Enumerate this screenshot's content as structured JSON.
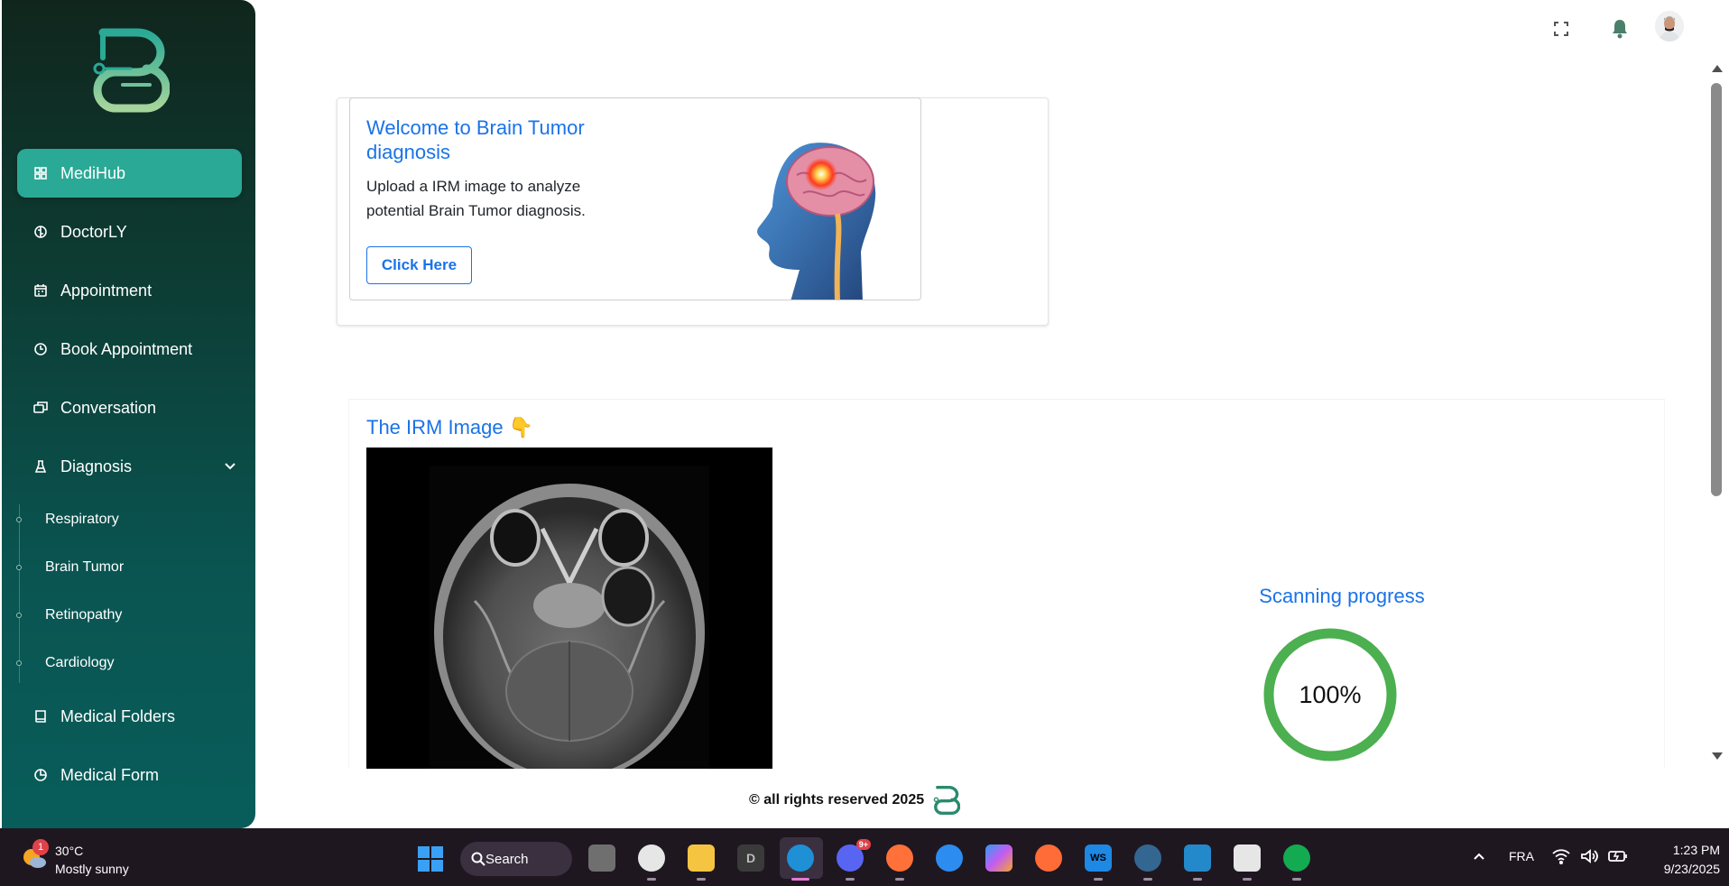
{
  "sidebar": {
    "items": [
      {
        "label": "MediHub",
        "icon": "grid-icon",
        "active": true
      },
      {
        "label": "DoctorLY",
        "icon": "brain-icon"
      },
      {
        "label": "Appointment",
        "icon": "calendar-icon"
      },
      {
        "label": "Book Appointment",
        "icon": "clock-icon"
      },
      {
        "label": "Conversation",
        "icon": "chat-icon"
      },
      {
        "label": "Diagnosis",
        "icon": "flask-icon",
        "expanded": true
      },
      {
        "label": "Medical Folders",
        "icon": "book-icon"
      },
      {
        "label": "Medical Form",
        "icon": "pie-icon"
      }
    ],
    "diagnosis_sub": [
      "Respiratory",
      "Brain Tumor",
      "Retinopathy",
      "Cardiology"
    ]
  },
  "welcome": {
    "title": "Welcome to Brain Tumor diagnosis",
    "description": "Upload a IRM image to analyze potential Brain Tumor diagnosis.",
    "button_label": "Click Here"
  },
  "irm": {
    "title": "The IRM Image 👇",
    "scan_title": "Scanning progress",
    "progress_value": 1.0,
    "progress_text": "100%"
  },
  "footer": {
    "text": "© all rights reserved 2025"
  },
  "taskbar": {
    "weather_temp": "30°C",
    "weather_condition": "Mostly sunny",
    "weather_badge": "1",
    "search_label": "Search",
    "lang": "FRA",
    "time": "1:23 PM",
    "date": "9/23/2025",
    "notif_badge": "9+",
    "app_d_letter": "D",
    "app_ws_letter": "WS"
  },
  "colors": {
    "accent": "#1a73e8",
    "sidebar_active": "#2aa996",
    "progress": "#4caf50"
  }
}
